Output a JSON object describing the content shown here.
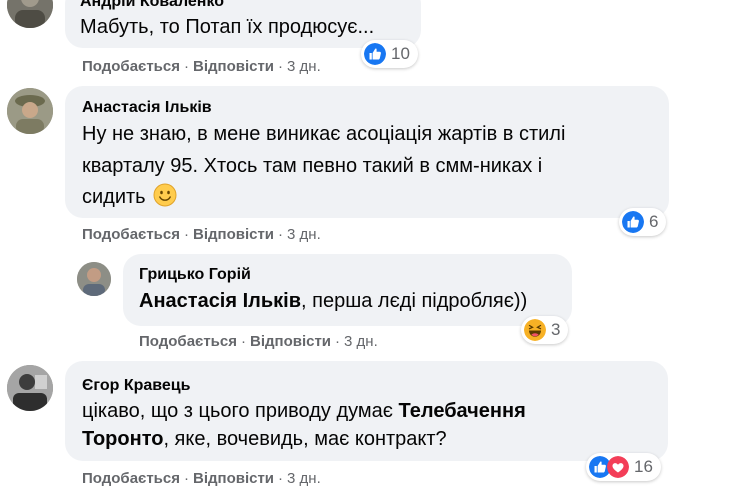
{
  "colors": {
    "bubble": "#f0f2f5",
    "secondary_text": "#65676b",
    "like_blue": "#1877f2",
    "love_red": "#f33e58",
    "emoji_yellow": "#f7b125"
  },
  "comments": [
    {
      "author": "Андрій Коваленко",
      "lines": [
        "Мабуть, то Потап їх продюсує..."
      ],
      "reactions": {
        "icons": [
          "like-icon"
        ],
        "count": "10"
      },
      "like_label": "Подобається",
      "reply_label": "Відповісти",
      "time": "3 дн."
    },
    {
      "author": "Анастасія Ільків",
      "lines": [
        "Ну не знаю, в мене виникає асоціація жартів в стилі",
        "кварталу 95. Хтось там певно такий в смм-никах і",
        "сидить"
      ],
      "reactions": {
        "icons": [
          "like-icon"
        ],
        "count": "6"
      },
      "like_label": "Подобається",
      "reply_label": "Відповісти",
      "time": "3 дн."
    },
    {
      "author": "Грицько Горій",
      "mention": "Анастасія Ільків",
      "lines": [
        ", перша лєді підробляє))"
      ],
      "reactions": {
        "icons": [
          "haha-icon"
        ],
        "count": "3"
      },
      "like_label": "Подобається",
      "reply_label": "Відповісти",
      "time": "3 дн."
    },
    {
      "author": "Єгор Кравець",
      "line1_pre": "цікаво, що з цього приводу думає ",
      "line1_bold": "Телебачення",
      "line2_bold": "Торонто",
      "line2_post": ", яке, вочевидь, має контракт?",
      "reactions": {
        "icons": [
          "like-icon",
          "love-icon"
        ],
        "count": "16"
      },
      "like_label": "Подобається",
      "reply_label": "Відповісти",
      "time": "3 дн."
    }
  ],
  "separator": "·"
}
